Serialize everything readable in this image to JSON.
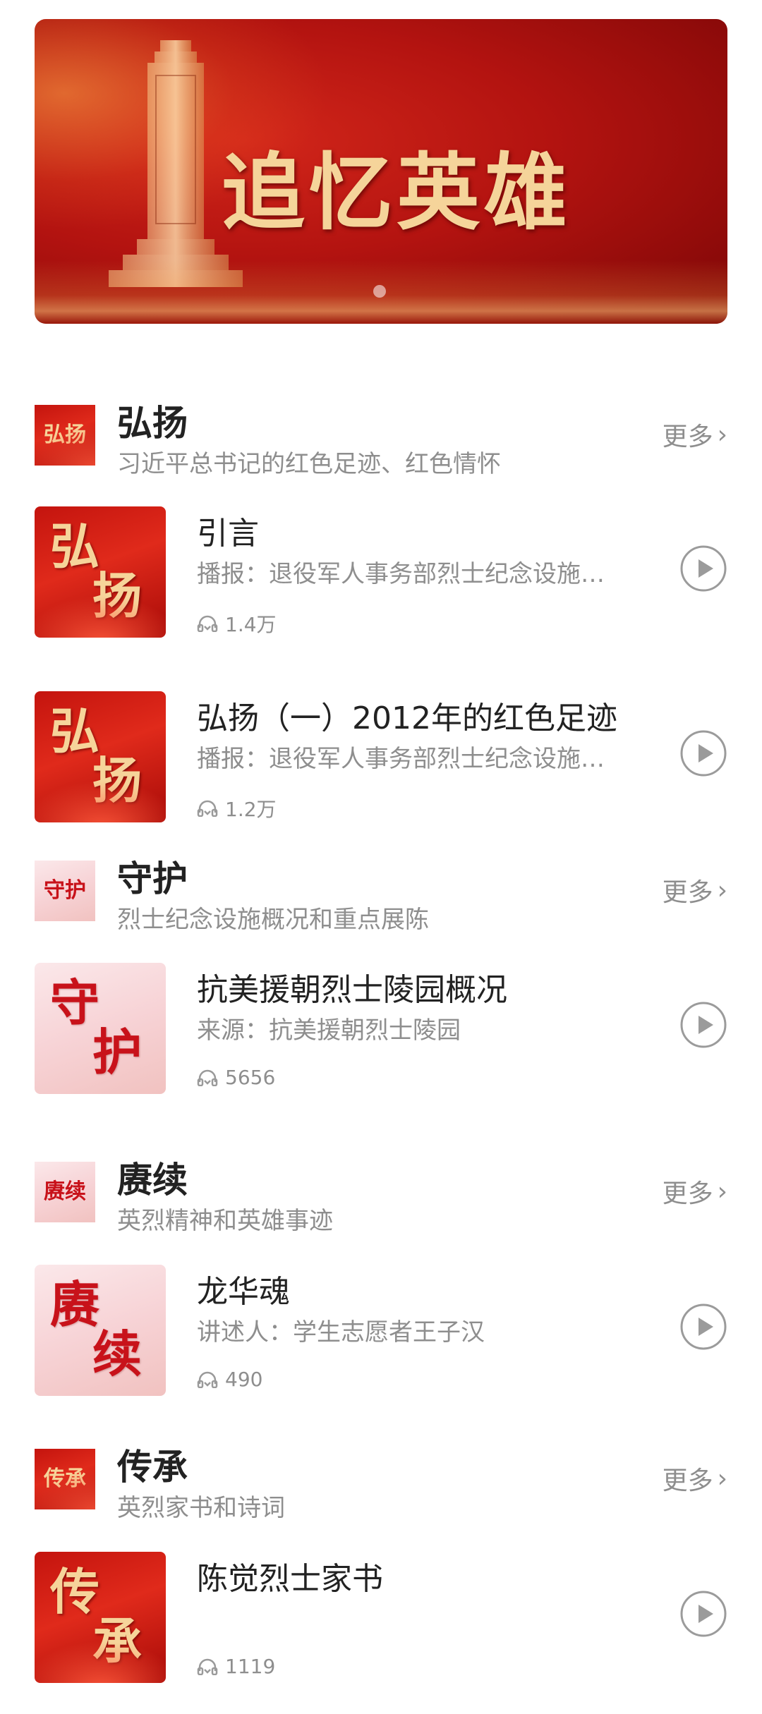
{
  "banner": {
    "title": "追忆英雄"
  },
  "sections": [
    {
      "title": "弘扬",
      "subtitle": "习近平总书记的红色足迹、红色情怀",
      "more": "更多",
      "thumb_text": "弘扬",
      "items": [
        {
          "title": "引言",
          "desc": "播报：退役军人事务部烈士纪念设施…",
          "plays": "1.4万",
          "cover_text": [
            "弘",
            "扬"
          ]
        },
        {
          "title": "弘扬（一）2012年的红色足迹",
          "desc": "播报：退役军人事务部烈士纪念设施…",
          "plays": "1.2万",
          "cover_text": [
            "弘",
            "扬"
          ]
        }
      ]
    },
    {
      "title": "守护",
      "subtitle": "烈士纪念设施概况和重点展陈",
      "more": "更多",
      "thumb_text": "守护",
      "items": [
        {
          "title": "抗美援朝烈士陵园概况",
          "desc": "来源：抗美援朝烈士陵园",
          "plays": "5656",
          "cover_text": [
            "守",
            "护"
          ]
        }
      ]
    },
    {
      "title": "赓续",
      "subtitle": "英烈精神和英雄事迹",
      "more": "更多",
      "thumb_text": "赓续",
      "items": [
        {
          "title": "龙华魂",
          "desc": "讲述人：学生志愿者王子汉",
          "plays": "490",
          "cover_text": [
            "赓",
            "续"
          ]
        }
      ]
    },
    {
      "title": "传承",
      "subtitle": "英烈家书和诗词",
      "more": "更多",
      "thumb_text": "传承",
      "items": [
        {
          "title": "陈觉烈士家书",
          "desc": "",
          "plays": "1119",
          "cover_text": [
            "传",
            "承"
          ]
        }
      ]
    }
  ],
  "icons": {
    "chevron": "chevron-right-icon",
    "headphones": "headphones-icon",
    "play": "play-icon"
  }
}
